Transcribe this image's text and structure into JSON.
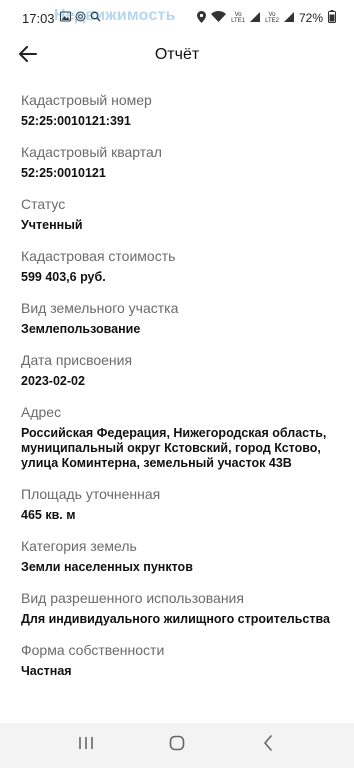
{
  "status_bar": {
    "time": "17:03",
    "watermark": "Недвижимость",
    "battery": "72%",
    "volte1": "VoLTE1",
    "volte2": "VoLTE2"
  },
  "header": {
    "title": "Отчёт"
  },
  "fields": [
    {
      "label": "Кадастровый номер",
      "value": "52:25:0010121:391"
    },
    {
      "label": "Кадастровый квартал",
      "value": "52:25:0010121"
    },
    {
      "label": "Статус",
      "value": "Учтенный"
    },
    {
      "label": "Кадастровая стоимость",
      "value": "599 403,6 руб."
    },
    {
      "label": "Вид земельного участка",
      "value": "Землепользование"
    },
    {
      "label": "Дата присвоения",
      "value": "2023-02-02"
    },
    {
      "label": "Адрес",
      "value": "Российская Федерация, Нижегородская область, муниципальный округ Кстовский, город Кстово, улица Коминтерна, земельный участок 43В"
    },
    {
      "label": "Площадь уточненная",
      "value": "465 кв. м"
    },
    {
      "label": "Категория земель",
      "value": "Земли населенных пунктов"
    },
    {
      "label": "Вид разрешенного использования",
      "value": "Для индивидуального жилищного строительства"
    },
    {
      "label": "Форма собственности",
      "value": "Частная"
    }
  ],
  "icons": {
    "back": "arrow-left-icon",
    "nav_recent": "recent-apps-icon",
    "nav_home": "home-icon",
    "nav_back": "nav-back-icon"
  }
}
